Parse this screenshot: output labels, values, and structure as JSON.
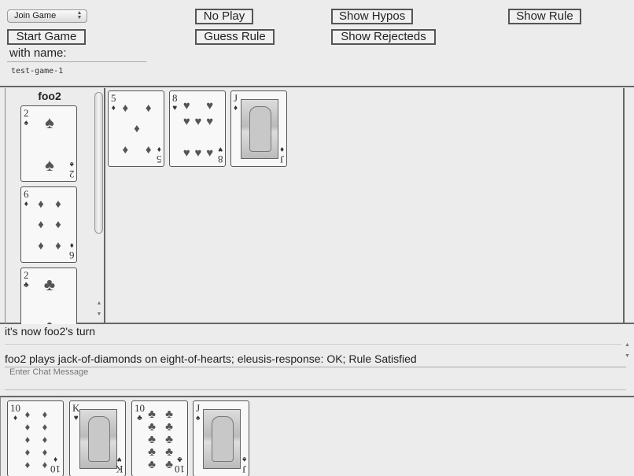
{
  "toolbar": {
    "join_select": "Join Game",
    "start_game": "Start Game",
    "no_play": "No Play",
    "guess_rule": "Guess Rule",
    "show_hypos": "Show Hypos",
    "show_rejecteds": "Show Rejecteds",
    "show_rule": "Show Rule",
    "with_name_label": "with name:",
    "name_value": "test-game-1"
  },
  "player_hand": {
    "player_name": "foo2",
    "cards": [
      {
        "rank": "2",
        "suit": "spades",
        "suit_char": "♠"
      },
      {
        "rank": "6",
        "suit": "diamonds",
        "suit_char": "♦"
      },
      {
        "rank": "2",
        "suit": "clubs",
        "suit_char": "♣"
      }
    ]
  },
  "play_area": {
    "cards": [
      {
        "rank": "5",
        "suit": "diamonds",
        "suit_char": "♦"
      },
      {
        "rank": "8",
        "suit": "hearts",
        "suit_char": "♥"
      },
      {
        "rank": "J",
        "suit": "diamonds",
        "suit_char": "♦"
      }
    ]
  },
  "messages": {
    "status": "it's now foo2's turn",
    "last_play": "foo2 plays jack-of-diamonds on eight-of-hearts; eleusis-response: OK; Rule Satisfied",
    "chat_placeholder": "Enter Chat Message"
  },
  "my_hand": {
    "cards": [
      {
        "rank": "10",
        "suit": "diamonds",
        "suit_char": "♦"
      },
      {
        "rank": "K",
        "suit": "hearts",
        "suit_char": "♥"
      },
      {
        "rank": "10",
        "suit": "clubs",
        "suit_char": "♣"
      },
      {
        "rank": "J",
        "suit": "spades",
        "suit_char": "♠"
      }
    ]
  }
}
